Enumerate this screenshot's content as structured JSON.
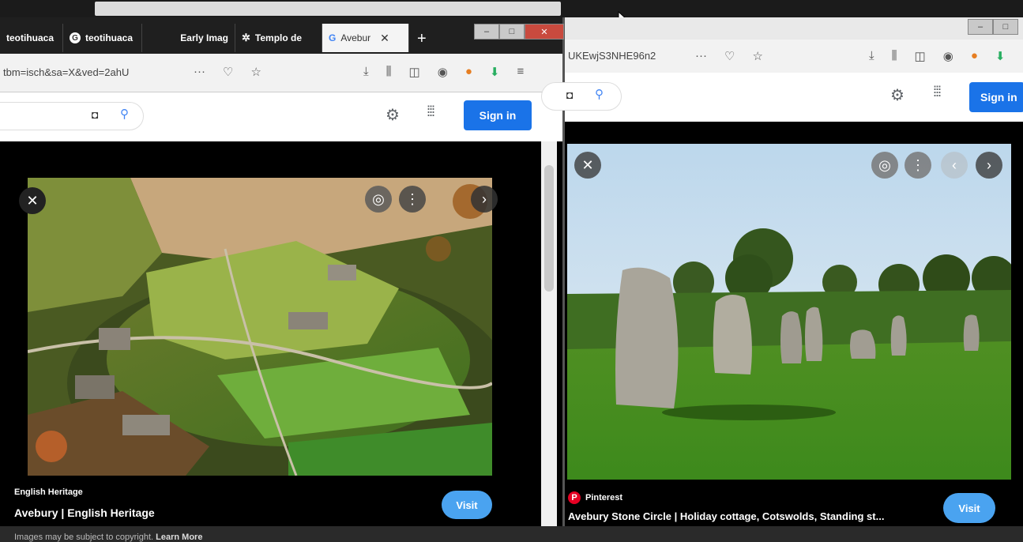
{
  "left_window": {
    "tabs": [
      {
        "label": "teotihuaca",
        "icon": "globe-icon"
      },
      {
        "label": "teotihuaca",
        "icon": "google-icon"
      },
      {
        "label": "Early Imag",
        "icon": ""
      },
      {
        "label": "Templo de",
        "icon": "flower-icon"
      },
      {
        "label": "Avebur",
        "icon": "google-g-icon",
        "active": true
      }
    ],
    "url": "tbm=isch&sa=X&ved=2ahU",
    "sign_in": "Sign in",
    "result": {
      "source": "English Heritage",
      "title": "Avebury | English Heritage",
      "copyright": "Images may be subject to copyright.",
      "learn_more": "Learn More",
      "visit": "Visit"
    }
  },
  "right_window": {
    "url": "UKEwjS3NHE96n2",
    "sign_in": "Sign in",
    "result": {
      "source": "Pinterest",
      "title": "Avebury Stone Circle | Holiday cottage, Cotswolds, Standing st...",
      "visit": "Visit"
    }
  },
  "colors": {
    "sign_in_blue": "#1a73e8",
    "visit_blue": "#4aa3f0",
    "close_red": "#c94a3e"
  }
}
